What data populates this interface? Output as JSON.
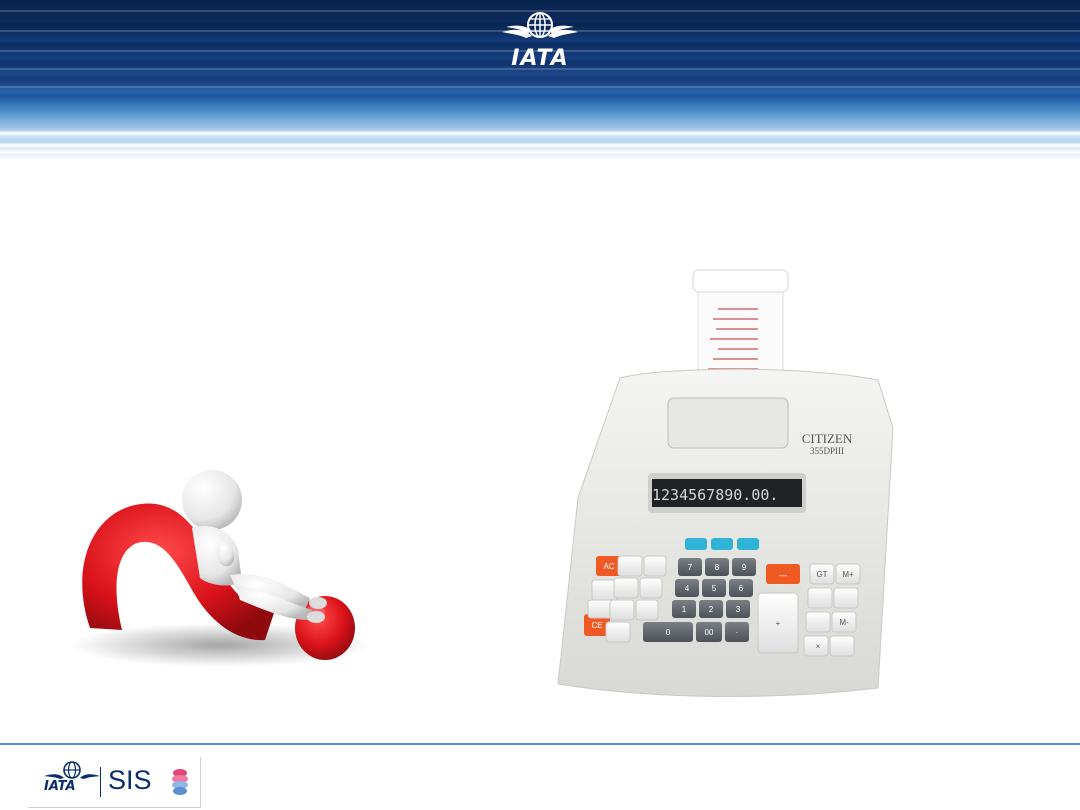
{
  "header": {
    "logo_text": "IATA",
    "logo_icon": "iata-globe-wings-icon"
  },
  "illustration_left": {
    "icon": "thinker-on-question-mark-icon"
  },
  "calculator": {
    "brand": "CITIZEN",
    "model": "355DPIII",
    "display": "1234567890.00.",
    "keys": {
      "ac": "AC",
      "ce": "CE",
      "minus": "—",
      "k7": "7",
      "k8": "8",
      "k9": "9",
      "k4": "4",
      "k5": "5",
      "k6": "6",
      "k1": "1",
      "k2": "2",
      "k3": "3",
      "k0": "0",
      "k00": "00",
      "kdot": "·",
      "plus": "+",
      "gt": "GT",
      "m_plus": "M+",
      "m_minus": "M-",
      "times": "×"
    }
  },
  "footer": {
    "iata_text": "IATA",
    "sis_text": "SIS",
    "sis_icon": "sis-stack-icon"
  },
  "colors": {
    "navy": "#0a2450",
    "footer_rule": "#4e8fd6",
    "question_red": "#d9121a",
    "key_orange": "#ef5a24",
    "key_cyan": "#2fb4d8"
  }
}
